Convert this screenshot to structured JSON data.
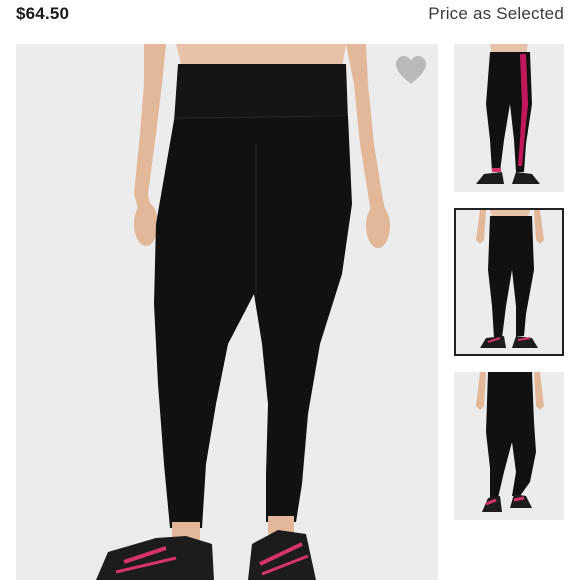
{
  "product": {
    "price": "$64.50",
    "price_note": "Price as Selected"
  },
  "main_image": {
    "alt": "Black high-waist leggings worn by model with black and pink sneakers"
  },
  "favorite": {
    "icon": "heart-icon",
    "color": "#b9b9b9"
  },
  "thumbnails": [
    {
      "alt": "Leggings with pink side stripe",
      "selected": false
    },
    {
      "alt": "Black leggings front view",
      "selected": true
    },
    {
      "alt": "Black leggings back view",
      "selected": false
    }
  ],
  "colors": {
    "legging": "#111111",
    "skin": "#e8c2a8",
    "accent_pink": "#d6336c",
    "background": "#ececec"
  }
}
